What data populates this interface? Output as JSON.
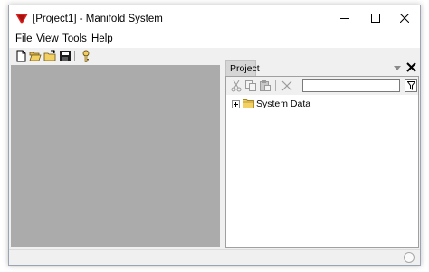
{
  "window": {
    "title": "[Project1] - Manifold System",
    "app_icon": "manifold-logo-icon",
    "controls": [
      "minimize-icon",
      "maximize-icon",
      "close-icon"
    ]
  },
  "menubar": {
    "items": [
      "File",
      "View",
      "Tools",
      "Help"
    ]
  },
  "toolbar": {
    "icons": [
      "new-file-icon",
      "open-folder-icon",
      "open-project-icon",
      "save-icon",
      "key-icon"
    ]
  },
  "project_panel": {
    "tab_label": "Project",
    "toolbar_icons": [
      "cut-icon",
      "copy-icon",
      "paste-icon",
      "delete-icon",
      "filter-icon"
    ],
    "search": {
      "value": "",
      "placeholder": ""
    },
    "tree": [
      {
        "label": "System Data",
        "icon": "folder-icon",
        "expander": "plus"
      }
    ]
  },
  "colors": {
    "workarea": "#ababab",
    "app_icon_red": "#d8201c",
    "folder_yellow": "#f2d063"
  }
}
